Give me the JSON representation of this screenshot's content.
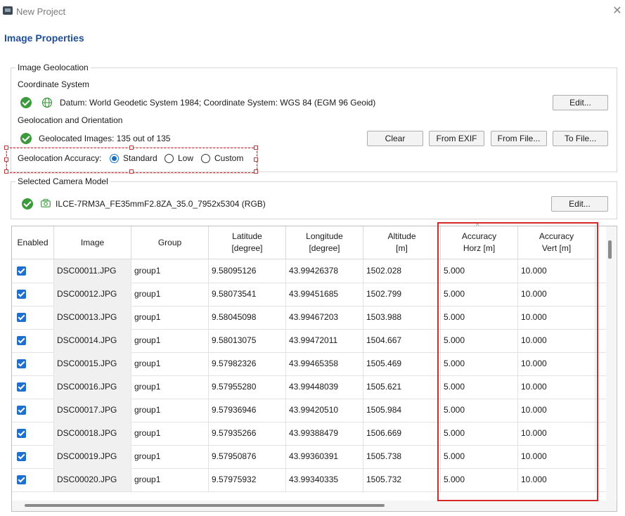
{
  "window": {
    "title": "New Project",
    "close_glyph": "✕"
  },
  "page_heading": "Image Properties",
  "geolocation_group": {
    "label": "Image Geolocation",
    "coordinate_system_label": "Coordinate System",
    "coordinate_system_value": "Datum: World Geodetic System 1984; Coordinate System: WGS 84 (EGM 96 Geoid)",
    "edit_button": "Edit...",
    "geo_orientation_label": "Geolocation and Orientation",
    "geolocated_images": "Geolocated Images: 135 out of 135",
    "buttons": {
      "clear": "Clear",
      "from_exif": "From EXIF",
      "from_file": "From File...",
      "to_file": "To File..."
    },
    "accuracy": {
      "label": "Geolocation Accuracy:",
      "options": [
        "Standard",
        "Low",
        "Custom"
      ],
      "selected": "Standard"
    }
  },
  "camera_group": {
    "label": "Selected Camera Model",
    "camera_model": "ILCE-7RM3A_FE35mmF2.8ZA_35.0_7952x5304 (RGB)",
    "edit_button": "Edit..."
  },
  "table": {
    "columns": {
      "enabled": "Enabled",
      "image": "Image",
      "group": "Group",
      "lat1": "Latitude",
      "lat2": "[degree]",
      "lon1": "Longitude",
      "lon2": "[degree]",
      "alt1": "Altitude",
      "alt2": "[m]",
      "ah1": "Accuracy",
      "ah2": "Horz [m]",
      "av1": "Accuracy",
      "av2": "Vert [m]"
    },
    "rows": [
      {
        "image": "DSC00011.JPG",
        "group": "group1",
        "lat": "9.58095126",
        "lon": "43.99426378",
        "alt": "1502.028",
        "acc_h": "5.000",
        "acc_v": "10.000"
      },
      {
        "image": "DSC00012.JPG",
        "group": "group1",
        "lat": "9.58073541",
        "lon": "43.99451685",
        "alt": "1502.799",
        "acc_h": "5.000",
        "acc_v": "10.000"
      },
      {
        "image": "DSC00013.JPG",
        "group": "group1",
        "lat": "9.58045098",
        "lon": "43.99467203",
        "alt": "1503.988",
        "acc_h": "5.000",
        "acc_v": "10.000"
      },
      {
        "image": "DSC00014.JPG",
        "group": "group1",
        "lat": "9.58013075",
        "lon": "43.99472011",
        "alt": "1504.667",
        "acc_h": "5.000",
        "acc_v": "10.000"
      },
      {
        "image": "DSC00015.JPG",
        "group": "group1",
        "lat": "9.57982326",
        "lon": "43.99465358",
        "alt": "1505.469",
        "acc_h": "5.000",
        "acc_v": "10.000"
      },
      {
        "image": "DSC00016.JPG",
        "group": "group1",
        "lat": "9.57955280",
        "lon": "43.99448039",
        "alt": "1505.621",
        "acc_h": "5.000",
        "acc_v": "10.000"
      },
      {
        "image": "DSC00017.JPG",
        "group": "group1",
        "lat": "9.57936946",
        "lon": "43.99420510",
        "alt": "1505.984",
        "acc_h": "5.000",
        "acc_v": "10.000"
      },
      {
        "image": "DSC00018.JPG",
        "group": "group1",
        "lat": "9.57935266",
        "lon": "43.99388479",
        "alt": "1506.669",
        "acc_h": "5.000",
        "acc_v": "10.000"
      },
      {
        "image": "DSC00019.JPG",
        "group": "group1",
        "lat": "9.57950876",
        "lon": "43.99360391",
        "alt": "1505.738",
        "acc_h": "5.000",
        "acc_v": "10.000"
      },
      {
        "image": "DSC00020.JPG",
        "group": "group1",
        "lat": "9.57975932",
        "lon": "43.99340335",
        "alt": "1505.732",
        "acc_h": "5.000",
        "acc_v": "10.000"
      }
    ]
  },
  "colors": {
    "heading": "#1f4e9a",
    "highlight": "#d62828",
    "check": "#3c9a3c",
    "checkbox": "#1f6fd1"
  }
}
